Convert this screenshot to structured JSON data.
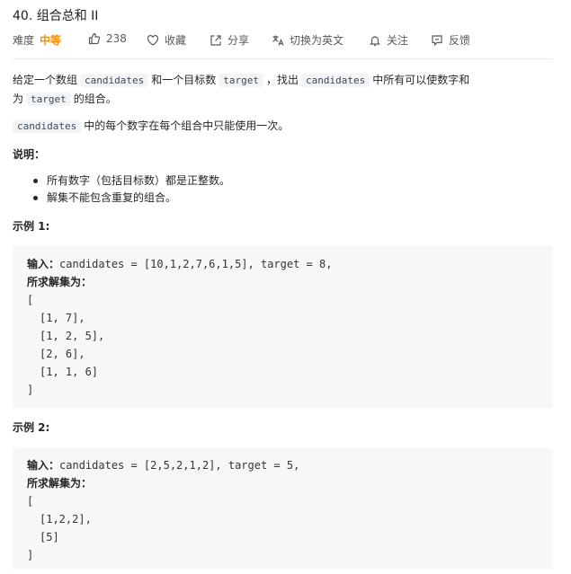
{
  "problem": {
    "title": "40. 组合总和 II",
    "difficulty_label": "难度",
    "difficulty_value": "中等",
    "likes": "238",
    "favorite": "收藏",
    "share": "分享",
    "translate": "切换为英文",
    "follow": "关注",
    "feedback": "反馈"
  },
  "description": {
    "p1_a": "给定一个数组",
    "p1_code1": "candidates",
    "p1_b": "和一个目标数",
    "p1_code2": "target",
    "p1_c": "，找出",
    "p1_code3": "candidates",
    "p1_d": "中所有可以使数字和",
    "p1_e": "为",
    "p1_code4": "target",
    "p1_f": "的组合。",
    "p2_code": "candidates",
    "p2_text": "中的每个数字在每个组合中只能使用一次。",
    "note_title": "说明：",
    "notes": [
      "所有数字（包括目标数）都是正整数。",
      "解集不能包含重复的组合。"
    ]
  },
  "examples": [
    {
      "title": "示例 1:",
      "input_label": "输入：",
      "input": "candidates = [10,1,2,7,6,1,5], target = 8,",
      "output_label": "所求解集为：",
      "lines": [
        "[",
        "[1, 7],",
        "[1, 2, 5],",
        "[2, 6],",
        "[1, 1, 6]",
        "]"
      ]
    },
    {
      "title": "示例 2:",
      "input_label": "输入：",
      "input": "candidates = [2,5,2,1,2], target = 5,",
      "output_label": "所求解集为：",
      "lines": [
        "[",
        "[1,2,2],",
        "[5]",
        "]"
      ]
    }
  ]
}
